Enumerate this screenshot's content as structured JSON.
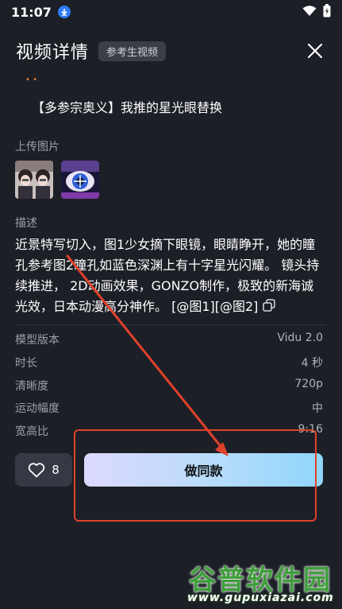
{
  "status_bar": {
    "time": "11:07",
    "download_icon": "download-icon",
    "wifi_icon": "wifi-icon",
    "battery_icon": "battery-icon"
  },
  "header": {
    "title": "视频详情",
    "badge": "参考生视频",
    "close_icon": "close-icon"
  },
  "prompt_title": "【多参宗奥义】我推的星光眼替换",
  "upload_section": {
    "label": "上传图片"
  },
  "description": {
    "label": "描述",
    "text": "近景特写切入，图1少女摘下眼镜，眼睛睁开，她的瞳孔参考图2瞳孔如蓝色深渊上有十字星光闪耀。 镜头持续推进， 2D动画效果，GONZO制作，极致的新海诚光效，日本动漫高分神作。 [@图1][@图2]"
  },
  "info": [
    {
      "label": "模型版本",
      "value": "Vidu 2.0"
    },
    {
      "label": "时长",
      "value": "4 秒"
    },
    {
      "label": "清晰度",
      "value": "720p"
    },
    {
      "label": "运动幅度",
      "value": "中"
    },
    {
      "label": "宽高比",
      "value": "9:16"
    }
  ],
  "actions": {
    "like_count": "8",
    "make_same": "做同款"
  },
  "watermark": {
    "title": "谷普软件园",
    "url": "www.gupuxiazai.com"
  },
  "colors": {
    "background": "#1c1f26",
    "annotation": "#e0412b",
    "accent_start": "#ddd9ff",
    "accent_end": "#90d6fb"
  }
}
